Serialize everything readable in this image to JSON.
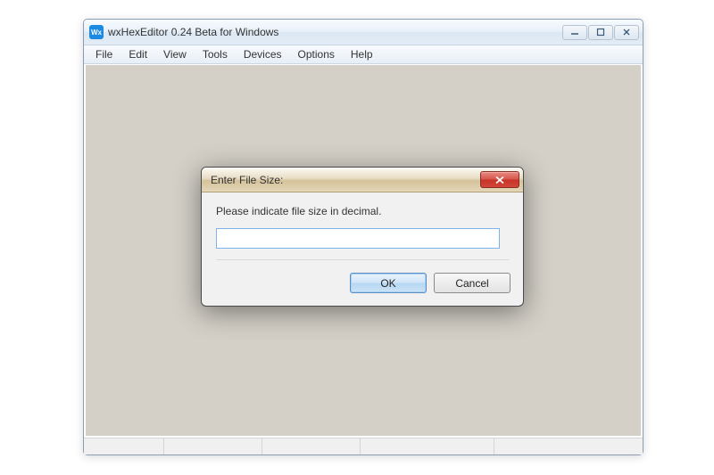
{
  "window": {
    "title": "wxHexEditor 0.24 Beta for Windows",
    "icon_text": "Wx"
  },
  "menu": {
    "file": "File",
    "edit": "Edit",
    "view": "View",
    "tools": "Tools",
    "devices": "Devices",
    "options": "Options",
    "help": "Help"
  },
  "dialog": {
    "title": "Enter File Size:",
    "prompt": "Please indicate file size in decimal.",
    "input_value": "",
    "ok": "OK",
    "cancel": "Cancel"
  }
}
